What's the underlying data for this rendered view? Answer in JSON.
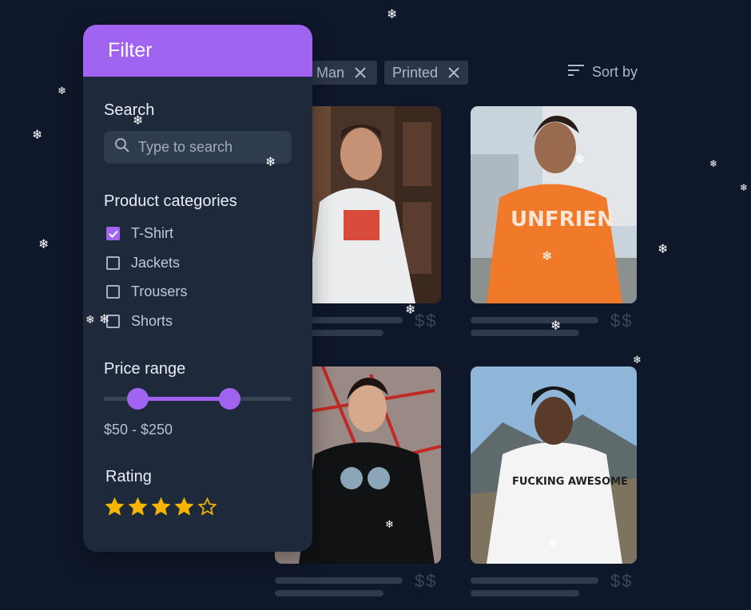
{
  "chips": [
    {
      "label": "Man"
    },
    {
      "label": "Printed"
    }
  ],
  "sort": {
    "label": "Sort by"
  },
  "products": [
    {
      "price": "$$",
      "image": "man-in-white-out-cast-tshirt"
    },
    {
      "price": "$$",
      "image": "man-in-orange-unfriend-tshirt"
    },
    {
      "price": "$$",
      "image": "person-in-black-tshirt"
    },
    {
      "price": "$$",
      "image": "man-in-white-tshirt-beanie"
    }
  ],
  "filter": {
    "title": "Filter",
    "search": {
      "title": "Search",
      "placeholder": "Type to search",
      "value": ""
    },
    "categories": {
      "title": "Product categories",
      "items": [
        {
          "label": "T-Shirt",
          "checked": true
        },
        {
          "label": "Jackets",
          "checked": false
        },
        {
          "label": "Trousers",
          "checked": false
        },
        {
          "label": "Shorts",
          "checked": false
        }
      ]
    },
    "price": {
      "title": "Price range",
      "min": 50,
      "max": 250,
      "label": "$50 - $250",
      "low_fraction": 0.18,
      "high_fraction": 0.67
    },
    "rating": {
      "title": "Rating",
      "value": 4,
      "max": 5
    }
  },
  "colors": {
    "accent": "#a064f0",
    "panel": "#1e293b",
    "background": "#0f172a",
    "star": "#f5b400"
  }
}
